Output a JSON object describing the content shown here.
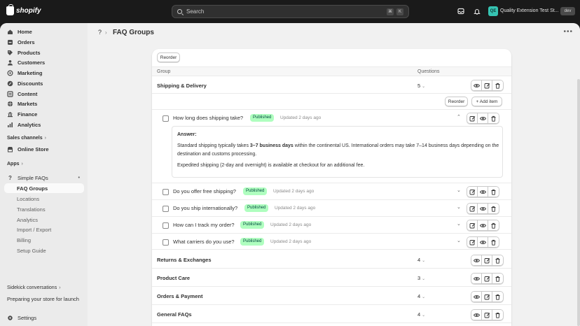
{
  "topbar": {
    "logo_text": "shopify",
    "search_placeholder": "Search",
    "kbd1": "⌘",
    "kbd2": "K",
    "store_initials": "QE",
    "store_name": "Quality Extension Test St...",
    "store_tag": "dev"
  },
  "sidebar": {
    "items": [
      {
        "label": "Home",
        "icon": "home-icon"
      },
      {
        "label": "Orders",
        "icon": "orders-icon"
      },
      {
        "label": "Products",
        "icon": "tag-icon"
      },
      {
        "label": "Customers",
        "icon": "person-icon"
      },
      {
        "label": "Marketing",
        "icon": "target-icon"
      },
      {
        "label": "Discounts",
        "icon": "discount-icon"
      },
      {
        "label": "Content",
        "icon": "content-icon"
      },
      {
        "label": "Markets",
        "icon": "globe-icon"
      },
      {
        "label": "Finance",
        "icon": "bank-icon"
      },
      {
        "label": "Analytics",
        "icon": "chart-icon"
      }
    ],
    "sales_channels_label": "Sales channels",
    "online_store": "Online Store",
    "apps_label": "Apps",
    "app_name": "Simple FAQs",
    "app_sub_items": [
      "FAQ Groups",
      "Locations",
      "Translations",
      "Analytics",
      "Import / Export",
      "Billing",
      "Setup Guide"
    ],
    "sidekick_label": "Sidekick conversations",
    "sidekick_item": "Preparing your store for launch",
    "settings": "Settings"
  },
  "page": {
    "title": "FAQ Groups",
    "reorder_label": "Reorder",
    "col_group": "Group",
    "col_questions": "Questions",
    "add_item_label": "+ Add item",
    "groups": [
      {
        "name": "Shipping & Delivery",
        "count": "5"
      },
      {
        "name": "Returns & Exchanges",
        "count": "4"
      },
      {
        "name": "Product Care",
        "count": "3"
      },
      {
        "name": "Orders & Payment",
        "count": "4"
      },
      {
        "name": "General FAQs",
        "count": "4"
      }
    ],
    "questions": [
      {
        "text": "How long does shipping take?",
        "status": "Published",
        "updated": "Updated 2 days ago"
      },
      {
        "text": "Do you offer free shipping?",
        "status": "Published",
        "updated": "Updated 2 days ago"
      },
      {
        "text": "Do you ship internationally?",
        "status": "Published",
        "updated": "Updated 2 days ago"
      },
      {
        "text": "How can I track my order?",
        "status": "Published",
        "updated": "Updated 2 days ago"
      },
      {
        "text": "What carriers do you use?",
        "status": "Published",
        "updated": "Updated 2 days ago"
      }
    ],
    "answer": {
      "label": "Answer:",
      "p1_pre": "Standard shipping typically takes ",
      "p1_bold": "3–7 business days",
      "p1_post": " within the continental US. International orders may take 7–14 business days depending on the destination and customs processing.",
      "p2": "Expedited shipping (2-day and overnight) is available at checkout for an additional fee."
    }
  }
}
